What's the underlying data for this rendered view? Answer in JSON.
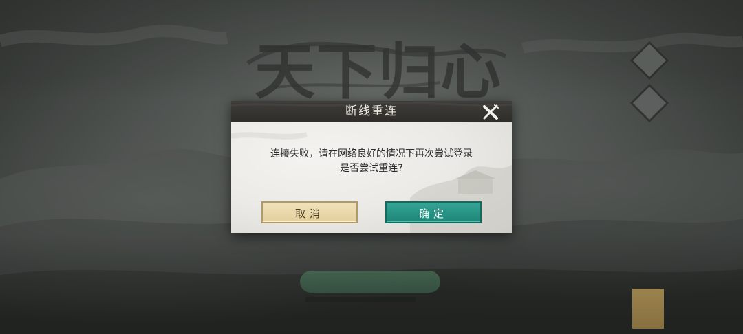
{
  "background": {
    "logo_text": "天下归心"
  },
  "dialog": {
    "title": "断线重连",
    "message_line1": "连接失败，请在网络良好的情况下再次尝试登录",
    "message_line2": "是否尝试重连?",
    "cancel_label": "取消",
    "confirm_label": "确定"
  },
  "colors": {
    "confirm_button": "#1f8577",
    "cancel_button": "#e3cf9c",
    "header": "#2f2d2a"
  }
}
